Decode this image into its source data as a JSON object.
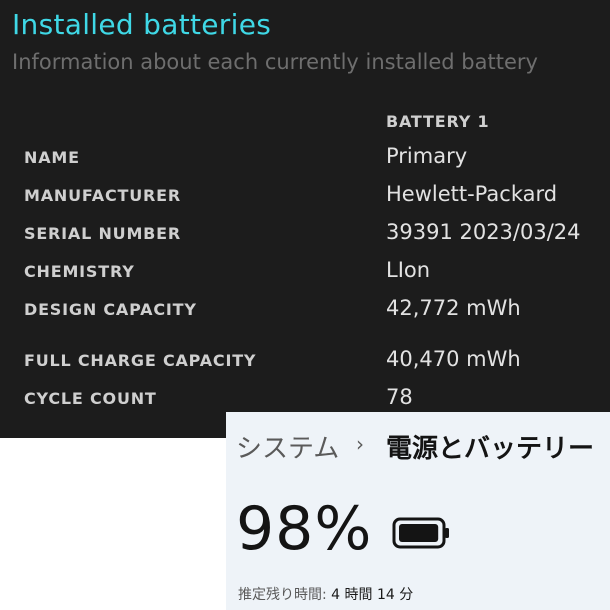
{
  "report": {
    "title": "Installed batteries",
    "subtitle": "Information about each currently installed battery",
    "column_header": "BATTERY 1",
    "rows": [
      {
        "label": "NAME",
        "value": "Primary"
      },
      {
        "label": "MANUFACTURER",
        "value": "Hewlett-Packard"
      },
      {
        "label": "SERIAL NUMBER",
        "value": "39391 2023/03/24"
      },
      {
        "label": "CHEMISTRY",
        "value": "LIon"
      },
      {
        "label": "DESIGN CAPACITY",
        "value": "42,772 mWh"
      },
      {
        "label": "FULL CHARGE CAPACITY",
        "value": "40,470 mWh"
      },
      {
        "label": "CYCLE COUNT",
        "value": "78"
      }
    ]
  },
  "settings": {
    "breadcrumb_parent": "システム",
    "breadcrumb_separator": "›",
    "breadcrumb_current": "電源とバッテリー",
    "battery_percent": "98%",
    "battery_level": 0.98,
    "battery_icon": "battery-full-icon",
    "remaining_label": "推定残り時間:",
    "remaining_value": "4 時間 14 分"
  },
  "colors": {
    "report_background": "#1c1c1c",
    "report_title": "#3fd8e6",
    "report_subtitle": "#6e6e6e",
    "settings_background": "#eef3f8"
  }
}
